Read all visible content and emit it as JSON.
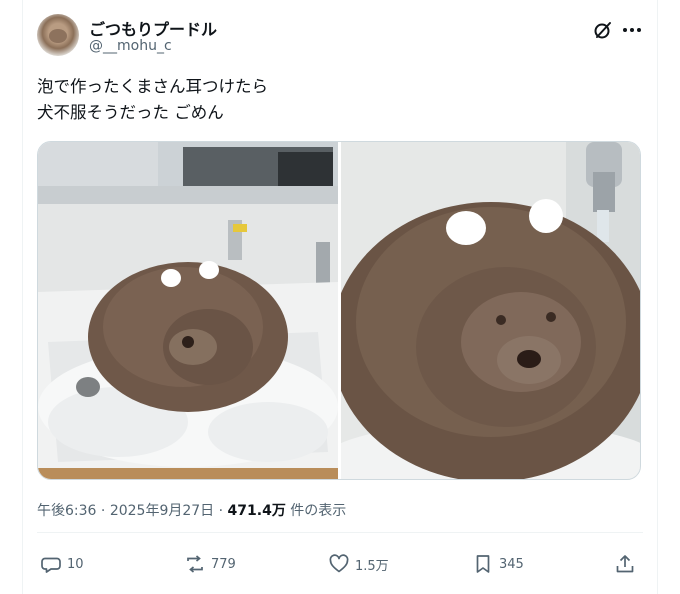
{
  "author": {
    "display_name": "ごつもりプードル",
    "handle": "@__mohu_c"
  },
  "icons": {
    "avatar": "avatar-dog-photo",
    "grok": "grok-icon",
    "more": "more-icon",
    "reply": "reply-icon",
    "repost": "repost-icon",
    "like": "like-icon",
    "bookmark": "bookmark-icon",
    "share": "share-icon"
  },
  "tweet": {
    "text": "泡で作ったくまさん耳つけたら\n犬不服そうだった ごめん",
    "time": "午後6:36",
    "sep1": " · ",
    "date": "2025年9月27日",
    "sep2": " · ",
    "views_count": "471.4万",
    "views_label": " 件の表示"
  },
  "stats": {
    "replies": "10",
    "reposts": "779",
    "likes": "1.5万",
    "bookmarks": "345"
  },
  "colors": {
    "text": "#0f1419",
    "secondary": "#536471",
    "border": "#cfd9de"
  }
}
